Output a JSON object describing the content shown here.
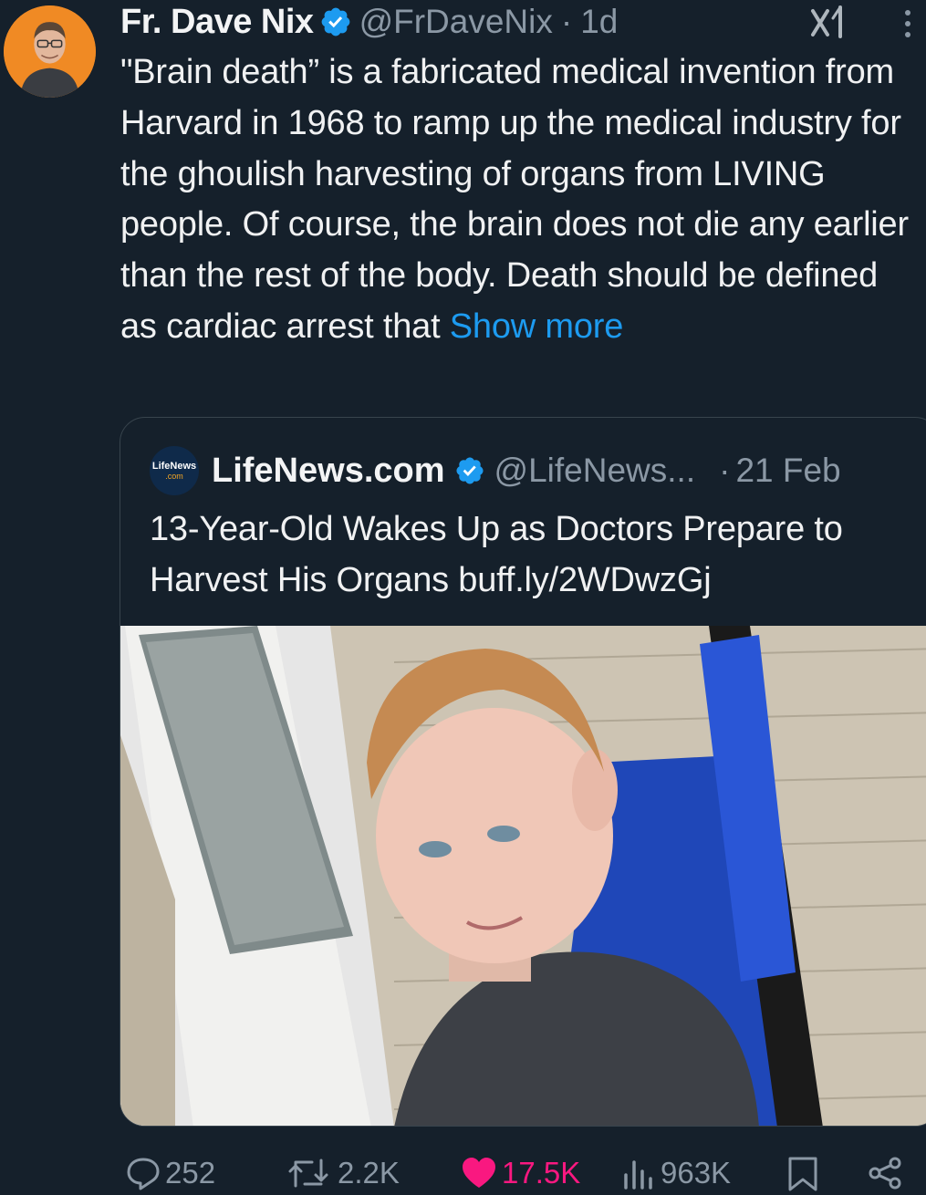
{
  "tweet": {
    "author_name": "Fr. Dave Nix",
    "author_handle": "@FrDaveNix",
    "separator": "·",
    "time": "1d",
    "text": "\"Brain death” is a fabricated medical invention from Harvard in 1968 to ramp up the medical industry for the ghoulish harvesting of organs from LIVING people.  Of course, the brain does not die any earlier than the rest of the body. Death should be defined as cardiac arrest that ",
    "show_more": "Show more"
  },
  "quote": {
    "logo_line1": "LifeNews",
    "logo_line2": ".com",
    "author_name": "LifeNews.com",
    "author_handle": "@LifeNews...",
    "separator": "·",
    "time": "21 Feb",
    "text": "13-Year-Old Wakes Up as Doctors Prepare to Harvest His Organs buff.ly/2WDwzGj"
  },
  "actions": {
    "replies": "252",
    "reposts": "2.2K",
    "likes": "17.5K",
    "views": "963K"
  },
  "colors": {
    "background": "#15202b",
    "accent": "#1d9bf0",
    "like": "#f91880",
    "muted": "#8b98a5",
    "avatar_bg": "#f08a24"
  },
  "icons": [
    "verified-badge-icon",
    "grok-icon",
    "more-icon",
    "reply-icon",
    "repost-icon",
    "like-icon",
    "views-icon",
    "bookmark-icon",
    "share-icon"
  ]
}
